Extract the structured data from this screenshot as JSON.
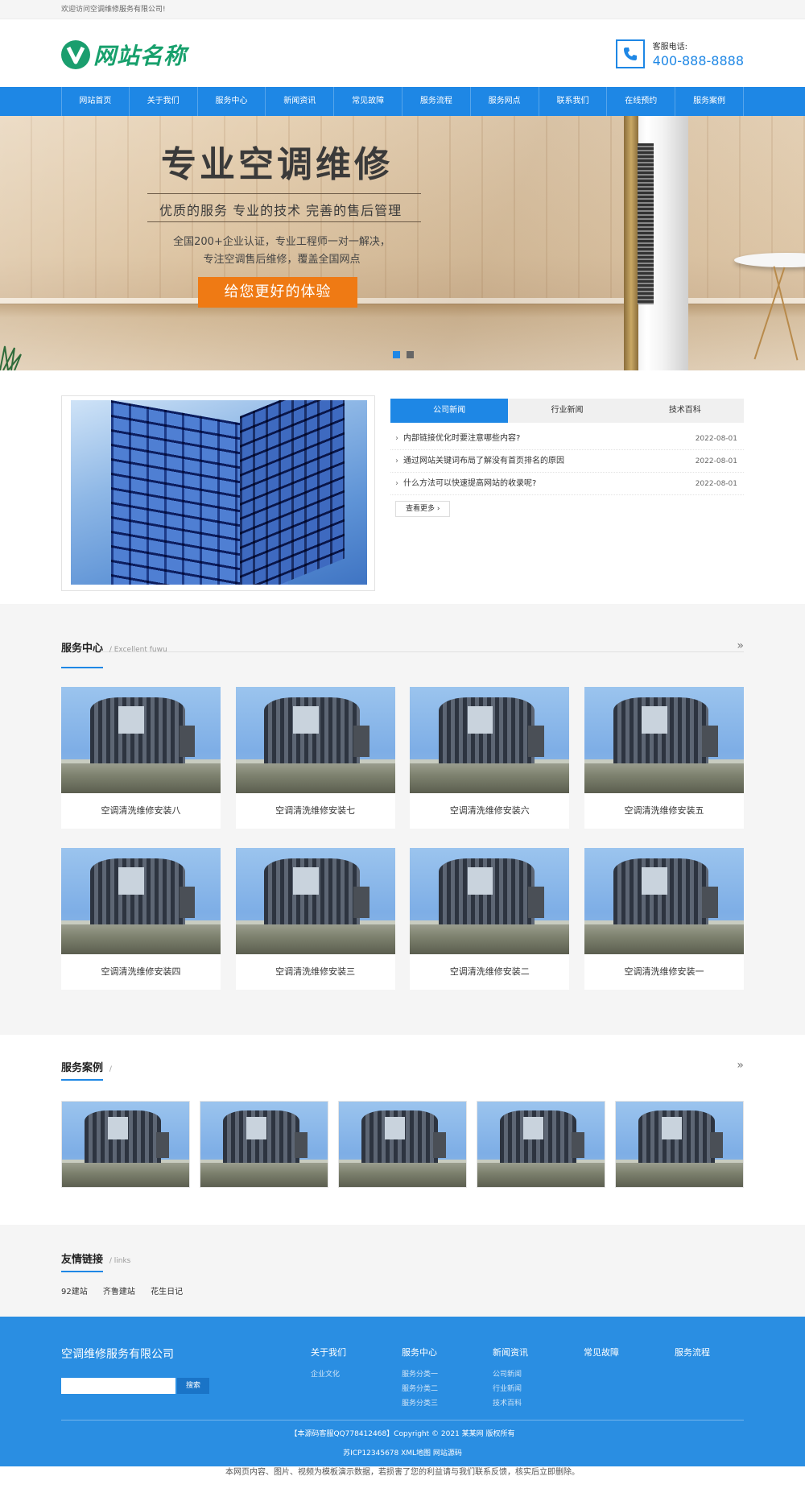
{
  "topbar": {
    "welcome": "欢迎访问空调维修服务有限公司!"
  },
  "header": {
    "logo_text": "网站名称",
    "hotline_label": "客服电话:",
    "hotline_number": "400-888-8888"
  },
  "nav": {
    "items": [
      "网站首页",
      "关于我们",
      "服务中心",
      "新闻资讯",
      "常见故障",
      "服务流程",
      "服务网点",
      "联系我们",
      "在线预约",
      "服务案例"
    ]
  },
  "banner": {
    "title": "专业空调维修",
    "subtitle": "优质的服务  专业的技术  完善的售后管理",
    "desc_line1": "全国200+企业认证，专业工程师一对一解决，",
    "desc_line2": "专注空调售后维修，覆盖全国网点",
    "button": "给您更好的体验"
  },
  "news": {
    "tabs": [
      "公司新闻",
      "行业新闻",
      "技术百科"
    ],
    "items": [
      {
        "title": "内部链接优化时要注意哪些内容?",
        "date": "2022-08-01"
      },
      {
        "title": "通过网站关键词布局了解没有首页排名的原因",
        "date": "2022-08-01"
      },
      {
        "title": "什么方法可以快速提高网站的收录呢?",
        "date": "2022-08-01"
      }
    ],
    "more": "查看更多 ›"
  },
  "services": {
    "title": "服务中心",
    "subtitle": "/ Excellent fuwu",
    "more_icon": "»",
    "items": [
      "空调清洗维修安装八",
      "空调清洗维修安装七",
      "空调清洗维修安装六",
      "空调清洗维修安装五",
      "空调清洗维修安装四",
      "空调清洗维修安装三",
      "空调清洗维修安装二",
      "空调清洗维修安装一"
    ]
  },
  "cases": {
    "title": "服务案例",
    "subtitle": "/",
    "more_icon": "»"
  },
  "links": {
    "title": "友情链接",
    "subtitle": "/ links",
    "items": [
      "92建站",
      "齐鲁建站",
      "花生日记"
    ]
  },
  "footer": {
    "company": "空调维修服务有限公司",
    "search_button": "搜索",
    "columns": [
      {
        "title": "关于我们",
        "items": [
          "企业文化"
        ]
      },
      {
        "title": "服务中心",
        "items": [
          "服务分类一",
          "服务分类二",
          "服务分类三"
        ]
      },
      {
        "title": "新闻资讯",
        "items": [
          "公司新闻",
          "行业新闻",
          "技术百科"
        ]
      },
      {
        "title": "常见故障",
        "items": []
      },
      {
        "title": "服务流程",
        "items": []
      }
    ],
    "copyright": "【本源码客服QQ778412468】Copyright © 2021 某某网 版权所有",
    "icp": "苏ICP12345678 XML地图 网站源码"
  },
  "bottom_note": "本网页内容、图片、视频为模板演示数据，若损害了您的利益请与我们联系反馈，核实后立即删除。",
  "colors": {
    "primary": "#1e87e5",
    "footer": "#2a8ee2",
    "logo": "#17a06c",
    "cta": "#ef7a14"
  }
}
